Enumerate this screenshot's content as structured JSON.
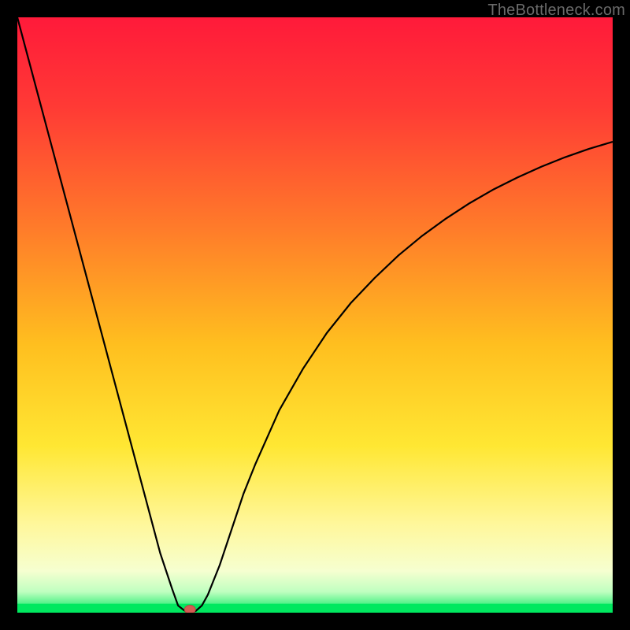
{
  "watermark": "TheBottleneck.com",
  "colors": {
    "frame": "#000000",
    "curve": "#000000",
    "bottom_band": "#00e85f",
    "marker_fill": "#d45c52",
    "marker_stroke": "#b34a42",
    "gradient_stops": [
      {
        "offset": 0.0,
        "color": "#ff1a3a"
      },
      {
        "offset": 0.15,
        "color": "#ff3a35"
      },
      {
        "offset": 0.35,
        "color": "#ff7a2a"
      },
      {
        "offset": 0.55,
        "color": "#ffbf1f"
      },
      {
        "offset": 0.72,
        "color": "#ffe733"
      },
      {
        "offset": 0.85,
        "color": "#fff79a"
      },
      {
        "offset": 0.93,
        "color": "#f6ffd0"
      },
      {
        "offset": 0.965,
        "color": "#bfffc0"
      },
      {
        "offset": 1.0,
        "color": "#00e85f"
      }
    ]
  },
  "chart_data": {
    "type": "line",
    "title": "",
    "xlabel": "",
    "ylabel": "",
    "xlim": [
      0,
      100
    ],
    "ylim": [
      0,
      100
    ],
    "x": [
      0,
      2,
      4,
      6,
      8,
      10,
      12,
      14,
      16,
      18,
      20,
      22,
      24,
      26,
      27,
      28,
      28.5,
      29,
      29.5,
      30,
      31,
      32,
      34,
      36,
      38,
      40,
      44,
      48,
      52,
      56,
      60,
      64,
      68,
      72,
      76,
      80,
      84,
      88,
      92,
      96,
      100
    ],
    "values": [
      100,
      92.5,
      85,
      77.5,
      70,
      62.5,
      55,
      47.5,
      40,
      32.5,
      25,
      17.5,
      10,
      4,
      1.2,
      0.4,
      0.1,
      0,
      0.1,
      0.3,
      1.2,
      3,
      8,
      14,
      20,
      25,
      34,
      41,
      47,
      52,
      56.2,
      60,
      63.3,
      66.2,
      68.8,
      71.1,
      73.1,
      74.9,
      76.5,
      77.9,
      79.1
    ],
    "marker": {
      "x": 29,
      "y": 0
    },
    "grid": false,
    "legend": false
  }
}
